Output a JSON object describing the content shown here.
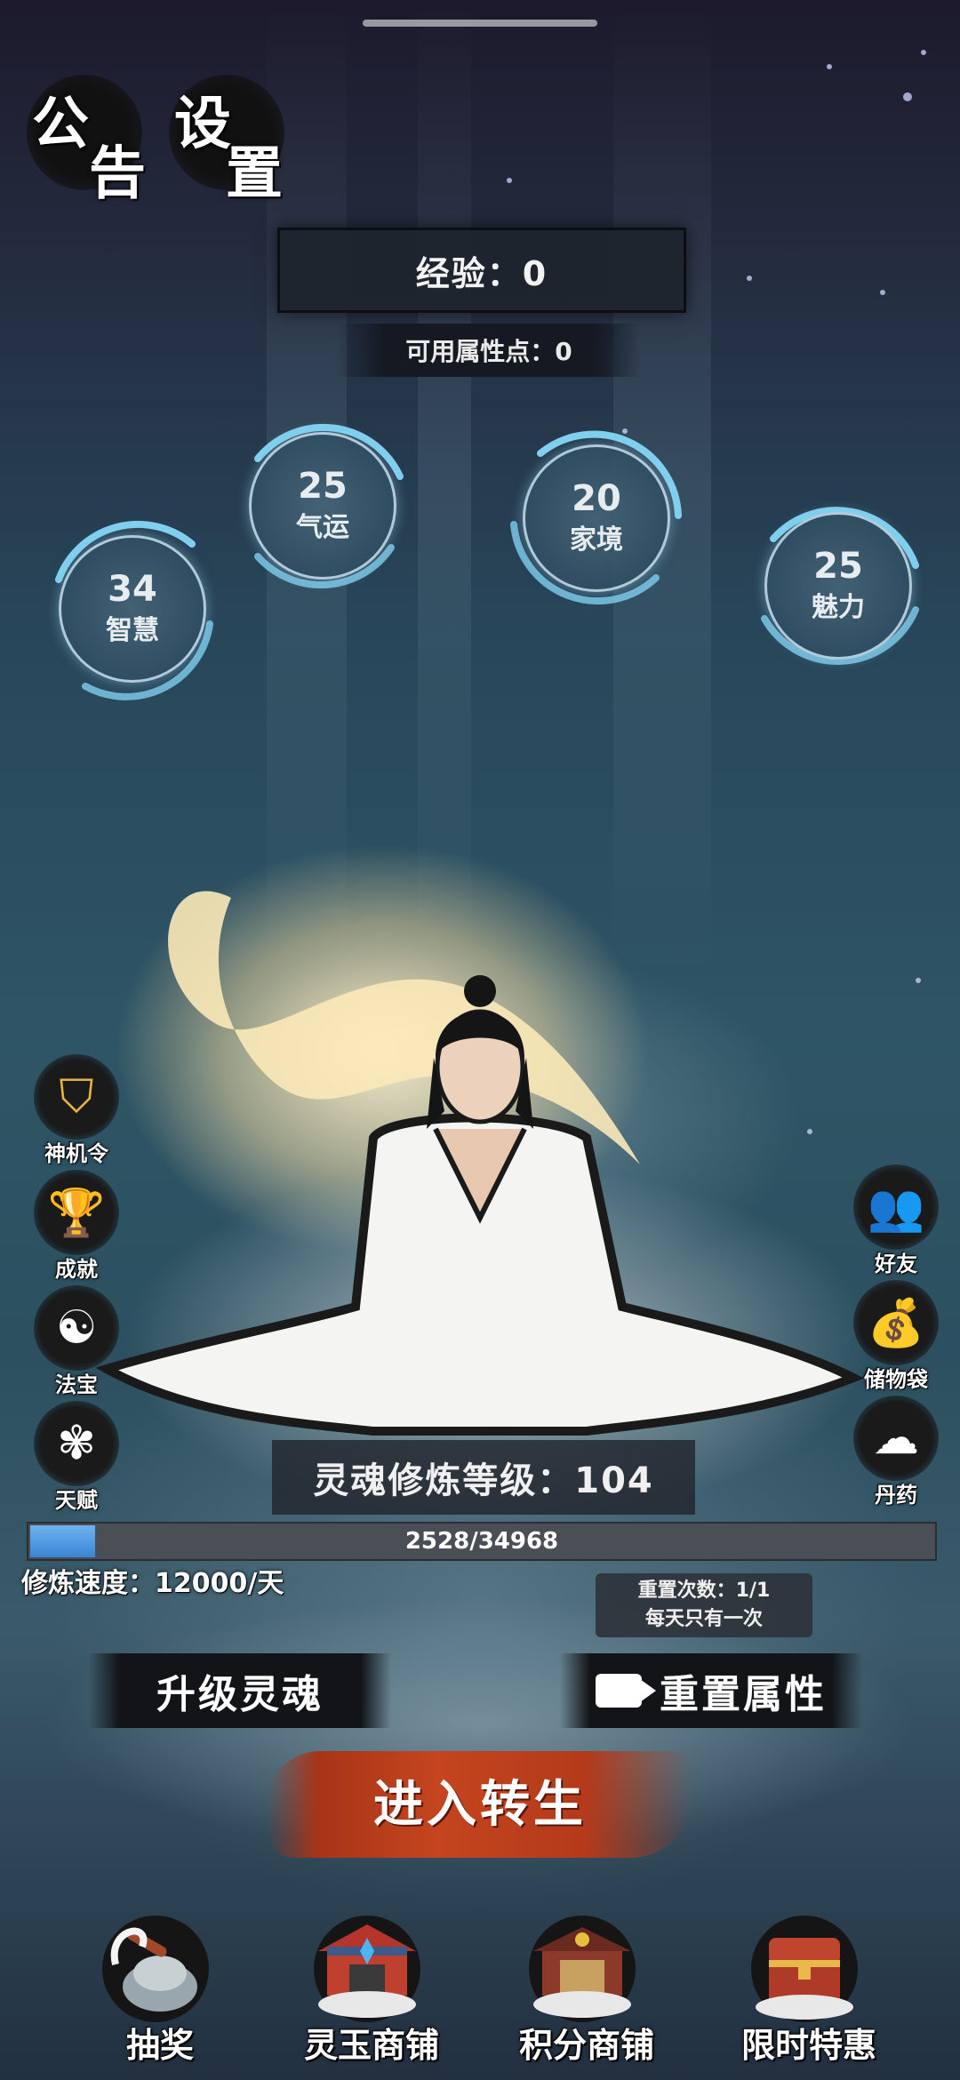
{
  "header": {
    "notice_chars": [
      "公",
      "告"
    ],
    "settings_chars": [
      "设",
      "置"
    ]
  },
  "exp": {
    "text": "经验：0"
  },
  "points": {
    "text": "可用属性点：0"
  },
  "attributes": [
    {
      "value": "34",
      "label": "智慧"
    },
    {
      "value": "25",
      "label": "气运"
    },
    {
      "value": "20",
      "label": "家境"
    },
    {
      "value": "25",
      "label": "魅力"
    }
  ],
  "left_menu": [
    {
      "label": "神机令",
      "icon": "trophy-shield-icon"
    },
    {
      "label": "成就",
      "icon": "trophy-icon"
    },
    {
      "label": "法宝",
      "icon": "yin-yang-icon"
    },
    {
      "label": "天赋",
      "icon": "talent-icon"
    }
  ],
  "right_menu": [
    {
      "label": "好友",
      "icon": "friends-icon"
    },
    {
      "label": "储物袋",
      "icon": "bag-icon"
    },
    {
      "label": "丹药",
      "icon": "gourd-icon"
    }
  ],
  "soul": {
    "level_text": "灵魂修炼等级：104",
    "progress_text": "2528/34968",
    "progress_current": 2528,
    "progress_max": 34968,
    "speed_text": "修炼速度：12000/天"
  },
  "reset_info": {
    "line1": "重置次数：1/1",
    "line2": "每天只有一次"
  },
  "actions": {
    "upgrade_soul": "升级灵魂",
    "reset_attributes": "重置属性",
    "enter_rebirth": "进入转生"
  },
  "bottom_shops": [
    {
      "label": "抽奖",
      "icon": "lottery-icon"
    },
    {
      "label": "灵玉商铺",
      "icon": "jade-shop-icon"
    },
    {
      "label": "积分商铺",
      "icon": "points-shop-icon"
    },
    {
      "label": "限时特惠",
      "icon": "treasure-chest-icon"
    }
  ],
  "colors": {
    "progress_fill": "#3a86d4",
    "rebirth_brush": "#c4451e",
    "ring": "#7fd0f0"
  }
}
